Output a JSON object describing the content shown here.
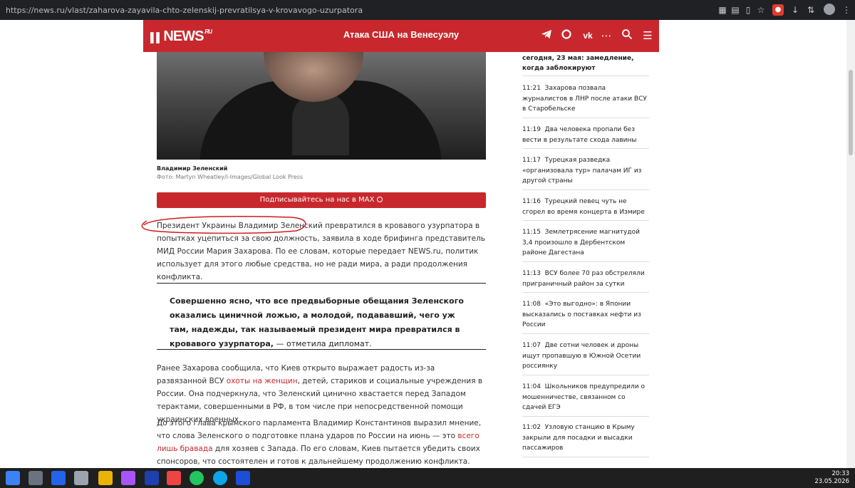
{
  "browser": {
    "url": "https://news.ru/vlast/zaharova-zayavila-chto-zelenskij-prevratilsya-v-krovavogo-uzurpatora"
  },
  "header": {
    "logo": "NEWS",
    "logo_sup": ".RU",
    "title": "Атака США на Венесуэлу"
  },
  "photo": {
    "caption_name": "Владимир Зеленский",
    "caption_credit": "Фото: Martyn Wheatley/i-Images/Global Look Press"
  },
  "subscribe": {
    "label": "Подписывайтесь на нас в MAX"
  },
  "article": {
    "p1": "Президент Украины Владимир Зеленский превратился в кровавого узурпатора в попытках уцепиться за свою должность, заявила в ходе брифинга представитель МИД России Мария Захарова. По ее словам, которые передает NEWS.ru, политик использует для этого любые средства, но не ради мира, а ради продолжения конфликта.",
    "quote_bold": "Совершенно ясно, что все предвыборные обещания Зеленского оказались циничной ложью, а молодой, подававший, чего уж там, надежды, так называемый президент мира превратился в кровавого узурпатора,",
    "quote_tail": " — отметила дипломат.",
    "p2_a": "Ранее Захарова сообщила, что Киев открыто выражает радость из-за развязанной ВСУ ",
    "p2_link": "охоты на женщин",
    "p2_b": ", детей, стариков и социальные учреждения в России. Она подчеркнула, что Зеленский цинично хвастается перед Западом терактами, совершенными в РФ, в том числе при непосредственной помощи украинских военных.",
    "p3_a": "До этого глава крымского парламента Владимир Константинов выразил мнение, что слова Зеленского о подготовке плана ударов по России на июнь — это ",
    "p3_link": "всего лишь бравада",
    "p3_b": " для хозяев с Запада. По его словам, Киев пытается убедить своих спонсоров, что состоятелен и готов к дальнейшему продолжению конфликта."
  },
  "sidebar": {
    "top_text": "сегодня, 23 мая: замедление, когда заблокируют",
    "items": [
      {
        "time": "11:21",
        "text": "Захарова позвала журналистов в ЛНР после атаки ВСУ в Старобельске"
      },
      {
        "time": "11:19",
        "text": "Два человека пропали без вести в результате схода лавины"
      },
      {
        "time": "11:17",
        "text": "Турецкая разведка «организовала тур» палачам ИГ из другой страны"
      },
      {
        "time": "11:16",
        "text": "Турецкий певец чуть не сгорел во время концерта в Измире"
      },
      {
        "time": "11:15",
        "text": "Землетрясение магнитудой 3,4 произошло в Дербентском районе Дагестана"
      },
      {
        "time": "11:13",
        "text": "ВСУ более 70 раз обстреляли приграничный район за сутки"
      },
      {
        "time": "11:08",
        "text": "«Это выгодно»: в Японии высказались о поставках нефти из России"
      },
      {
        "time": "11:07",
        "text": "Две сотни человек и дроны ищут пропавшую в Южной Осетии россиянку"
      },
      {
        "time": "11:04",
        "text": "Школьников предупредили о мошенничестве, связанном со сдачей ЕГЭ"
      },
      {
        "time": "11:02",
        "text": "Узловую станцию в Крыму закрыли для посадки и высадки пассажиров"
      }
    ]
  },
  "taskbar": {
    "time": "20:33",
    "date": "23.05.2026"
  },
  "colors": {
    "brand": "#c8282d",
    "link": "#c8282d"
  }
}
